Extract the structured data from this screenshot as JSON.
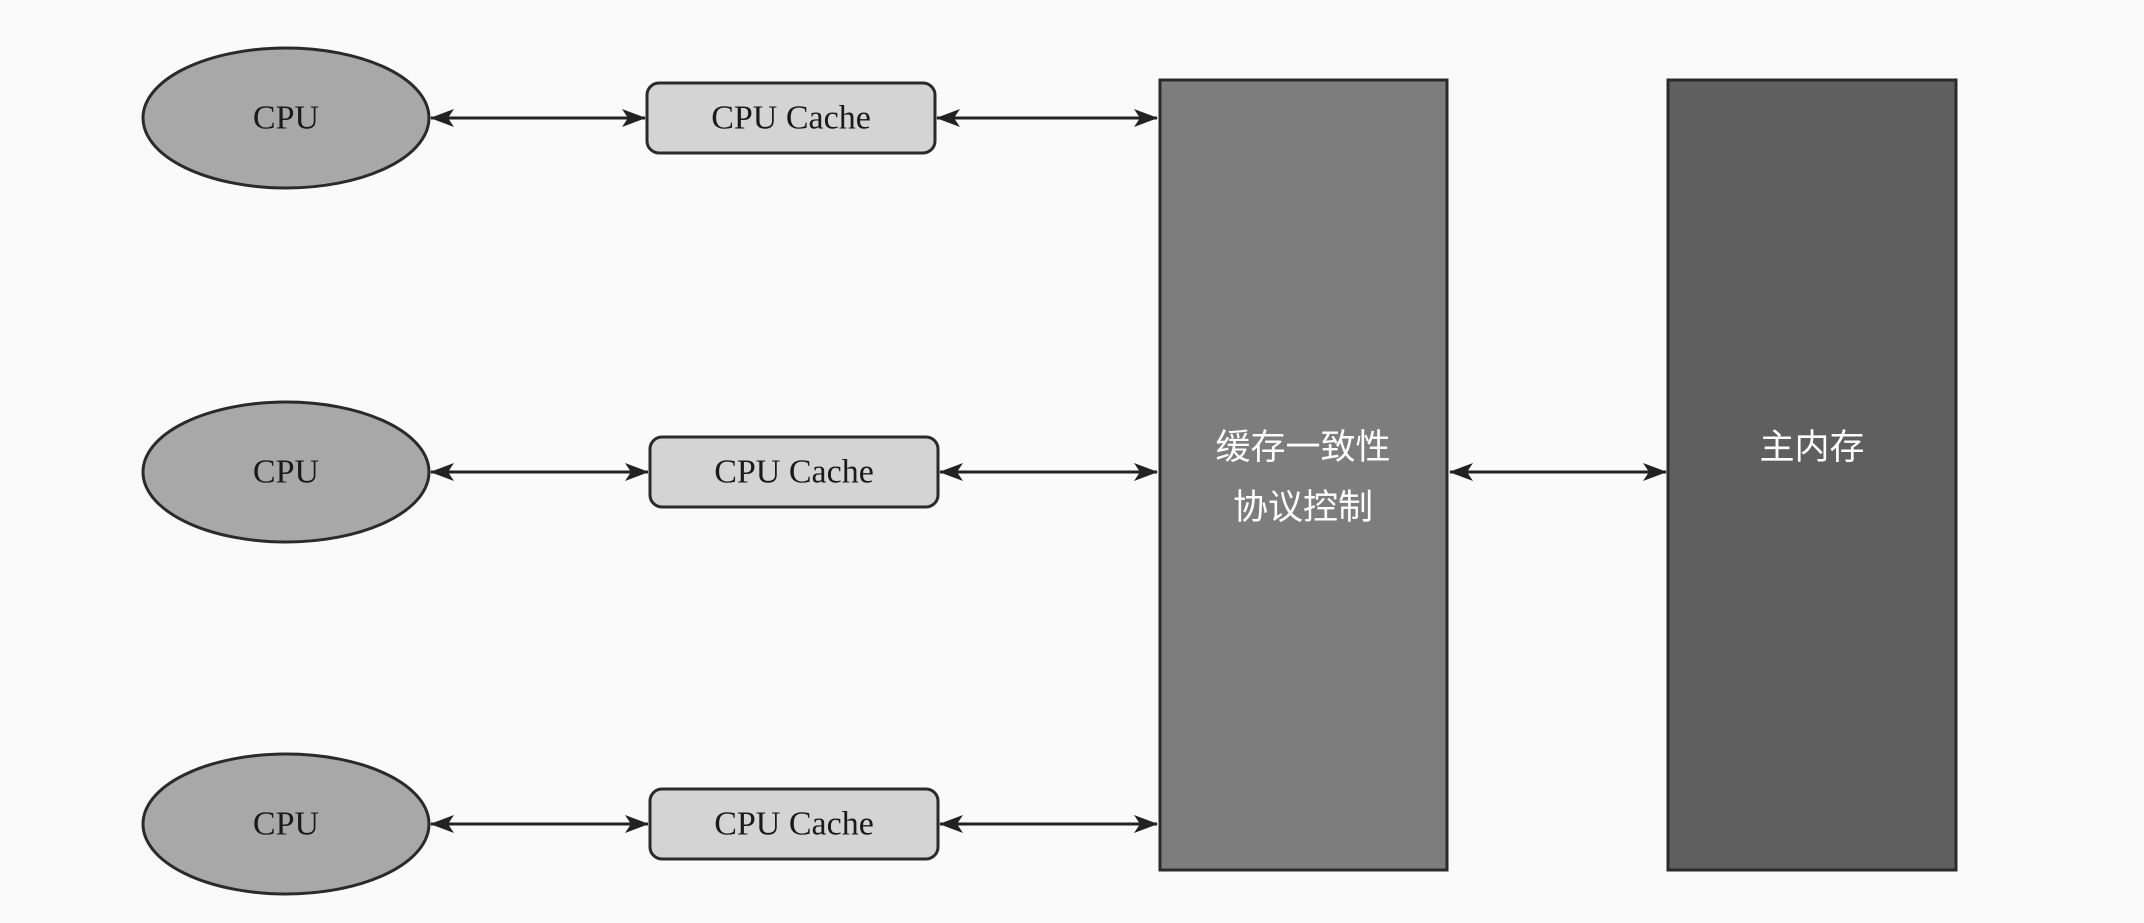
{
  "cpus": [
    {
      "label": "CPU"
    },
    {
      "label": "CPU"
    },
    {
      "label": "CPU"
    }
  ],
  "caches": [
    {
      "label": "CPU Cache"
    },
    {
      "label": "CPU Cache"
    },
    {
      "label": "CPU Cache"
    }
  ],
  "coherence_controller": {
    "label_line1": "缓存一致性",
    "label_line2": "协议控制"
  },
  "main_memory": {
    "label": "主内存"
  },
  "colors": {
    "cpu_fill": "#a8a8a8",
    "cache_fill": "#d4d4d4",
    "controller_fill": "#7d7d7d",
    "memory_fill": "#5f5f5f",
    "stroke": "#2a2a2a",
    "arrow": "#222222"
  }
}
